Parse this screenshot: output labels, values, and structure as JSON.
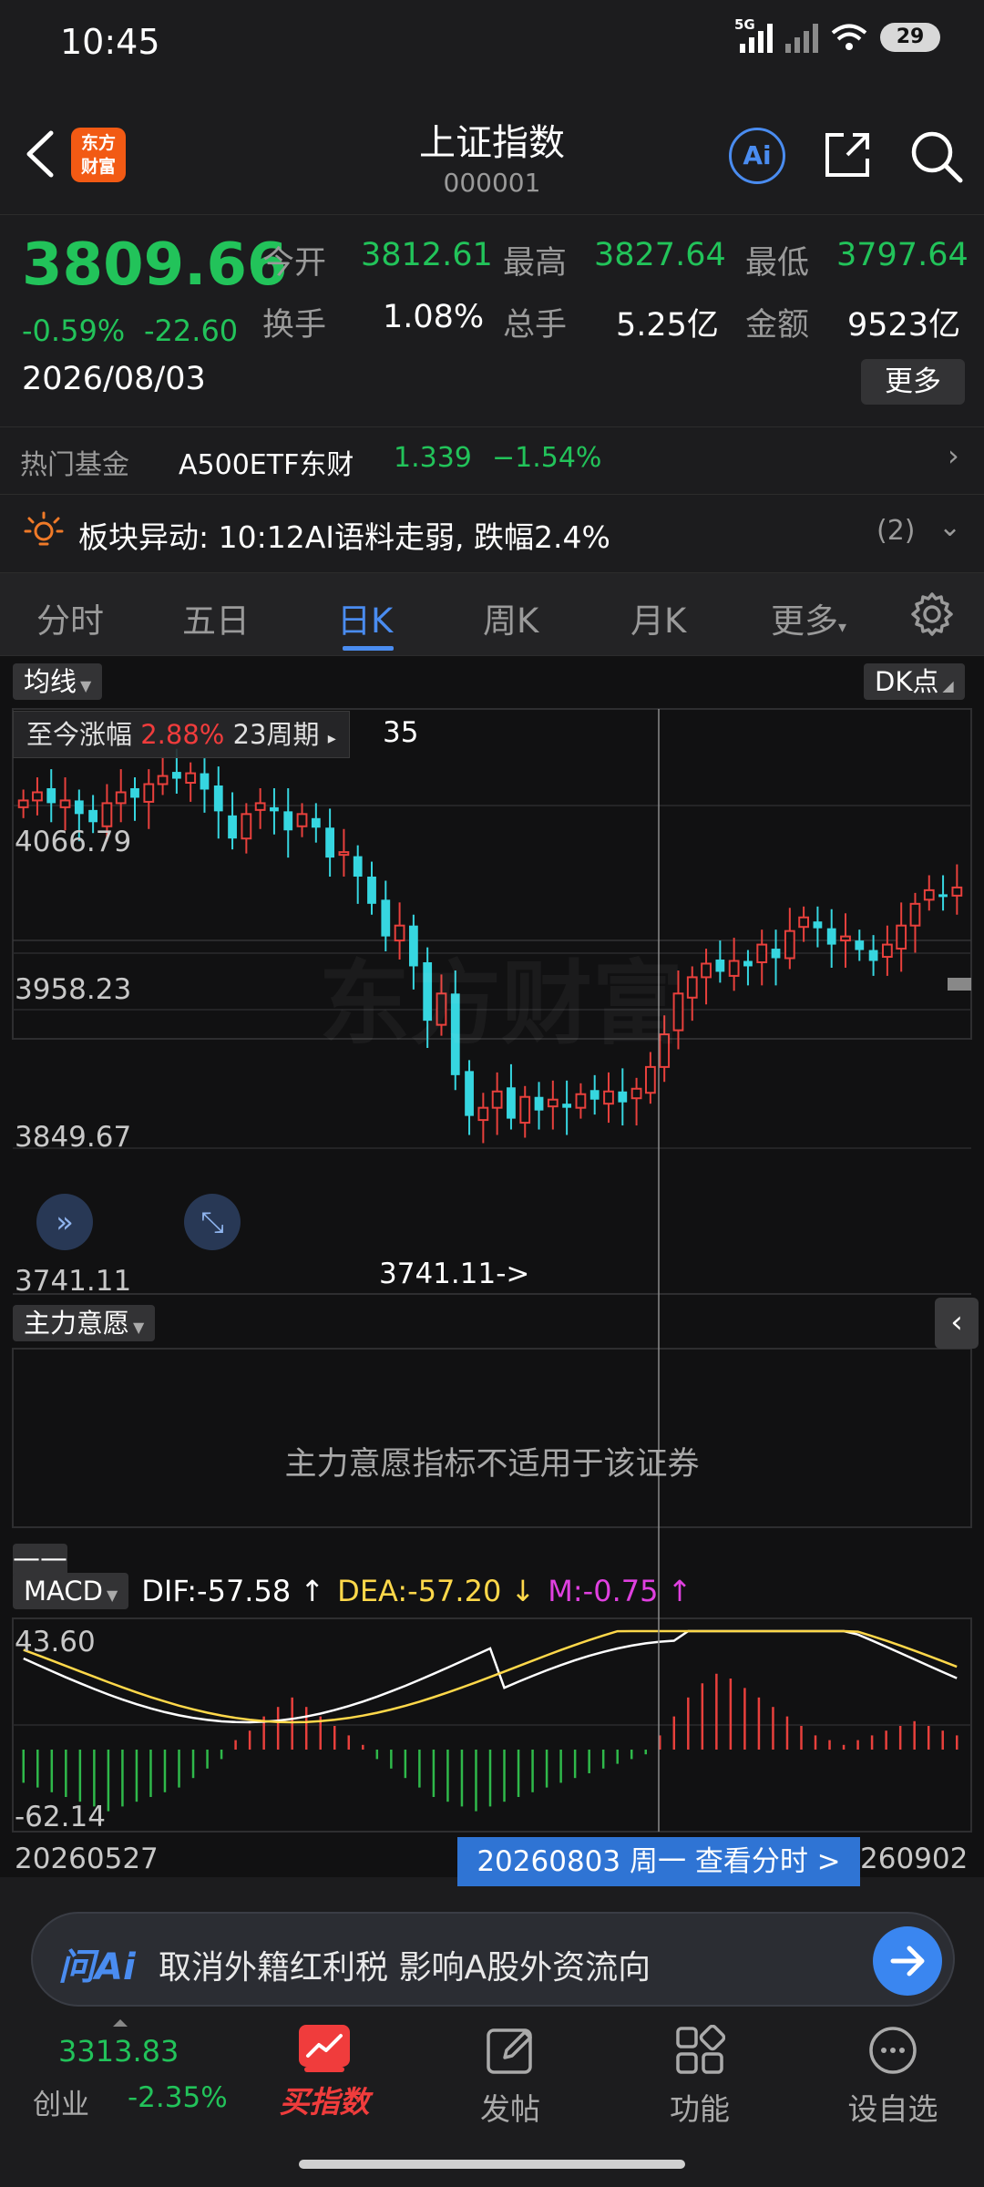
{
  "status_bar": {
    "time": "10:45",
    "network": "5G",
    "battery": "29"
  },
  "header": {
    "title": "上证指数",
    "code": "000001",
    "logo_text_line1": "东方",
    "logo_text_line2": "财富",
    "ai_label": "Ai"
  },
  "quote": {
    "price": "3809.66",
    "change_pct": "-0.59%",
    "change": "-22.60",
    "date": "2026/08/03",
    "fields": [
      {
        "label": "今开",
        "value": "3812.61"
      },
      {
        "label": "最高",
        "value": "3827.64"
      },
      {
        "label": "最低",
        "value": "3797.64"
      },
      {
        "label": "换手",
        "value": "1.08%"
      },
      {
        "label": "总手",
        "value": "5.25亿"
      },
      {
        "label": "金额",
        "value": "9523亿"
      }
    ],
    "more_label": "更多"
  },
  "hot_fund": {
    "label": "热门基金",
    "name": "A500ETF东财",
    "price": "1.339",
    "change": "−1.54%"
  },
  "alert": {
    "text": "板块异动: 10:12AI语料走弱, 跌幅2.4%",
    "count": "(2)"
  },
  "tabs": [
    {
      "label": "分时"
    },
    {
      "label": "五日"
    },
    {
      "label": "日K",
      "active": true
    },
    {
      "label": "周K"
    },
    {
      "label": "月K"
    },
    {
      "label": "更多"
    }
  ],
  "chart": {
    "ma_button": "均线",
    "dk_button": "DK点",
    "info_prefix": "至今涨幅",
    "info_pct": "2.88%",
    "info_period": "23周期",
    "info_tail": "35",
    "price_labels": [
      "4066.79",
      "3958.23",
      "3849.67",
      "3741.11"
    ],
    "low_marker": "3741.11->",
    "watermark": "东方财富",
    "indicator2_button": "主力意愿",
    "indicator2_message": "主力意愿指标不适用于该证券",
    "dash_label": "——",
    "macd_button": "MACD",
    "dif": "DIF:-57.58",
    "dea": "DEA:-57.20",
    "m": "M:-0.75",
    "macd_top": "43.60",
    "macd_bottom": "-62.14",
    "date_left": "20260527",
    "date_right": "260902",
    "date_pill": "20260803 周一 查看分时 >"
  },
  "chart_data": {
    "type": "candlestick",
    "y_axis_labels": [
      4066.79,
      3958.23,
      3849.67,
      3741.11
    ],
    "low_marker_value": 3741.11,
    "macd": {
      "dif": -57.58,
      "dea": -57.2,
      "m": -0.75,
      "range": [
        -62.14,
        43.6
      ]
    },
    "x_labels": [
      "20260527",
      "20260803",
      "260902"
    ]
  },
  "ask_ai": {
    "logo": "问Ai",
    "prompt": "取消外籍红利税 影响A股外资流向"
  },
  "bottom_nav": {
    "ticker_value": "3313.83",
    "ticker_name": "创业",
    "ticker_change": "-2.35%",
    "items": [
      {
        "label": "买指数"
      },
      {
        "label": "发帖"
      },
      {
        "label": "功能"
      },
      {
        "label": "设自选"
      }
    ]
  }
}
